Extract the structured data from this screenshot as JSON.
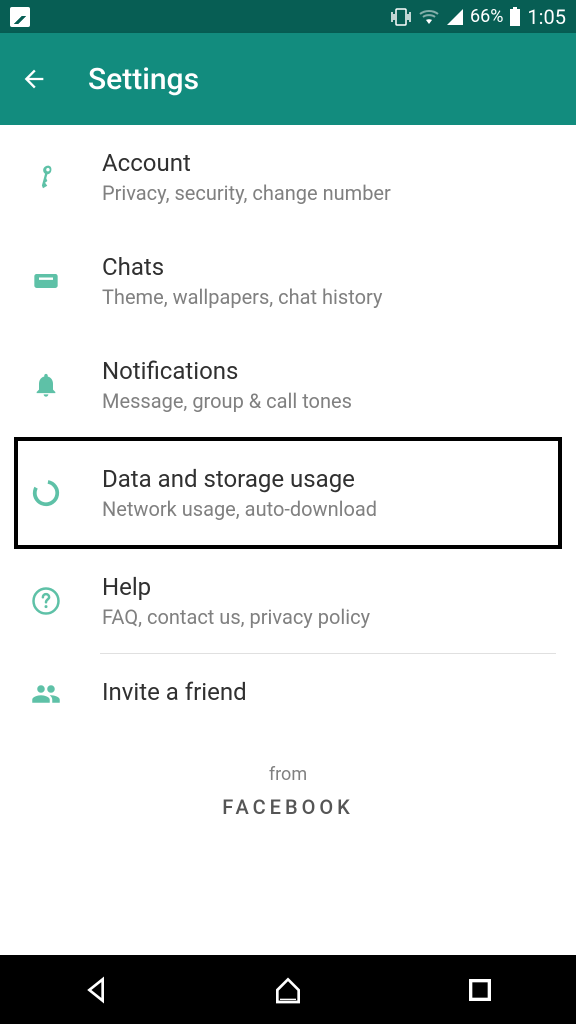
{
  "status": {
    "battery": "66%",
    "time": "1:05"
  },
  "header": {
    "title": "Settings"
  },
  "items": [
    {
      "title": "Account",
      "subtitle": "Privacy, security, change number"
    },
    {
      "title": "Chats",
      "subtitle": "Theme, wallpapers, chat history"
    },
    {
      "title": "Notifications",
      "subtitle": "Message, group & call tones"
    },
    {
      "title": "Data and storage usage",
      "subtitle": "Network usage, auto-download"
    },
    {
      "title": "Help",
      "subtitle": "FAQ, contact us, privacy policy"
    },
    {
      "title": "Invite a friend",
      "subtitle": ""
    }
  ],
  "footer": {
    "from": "from",
    "brand": "FACEBOOK"
  }
}
